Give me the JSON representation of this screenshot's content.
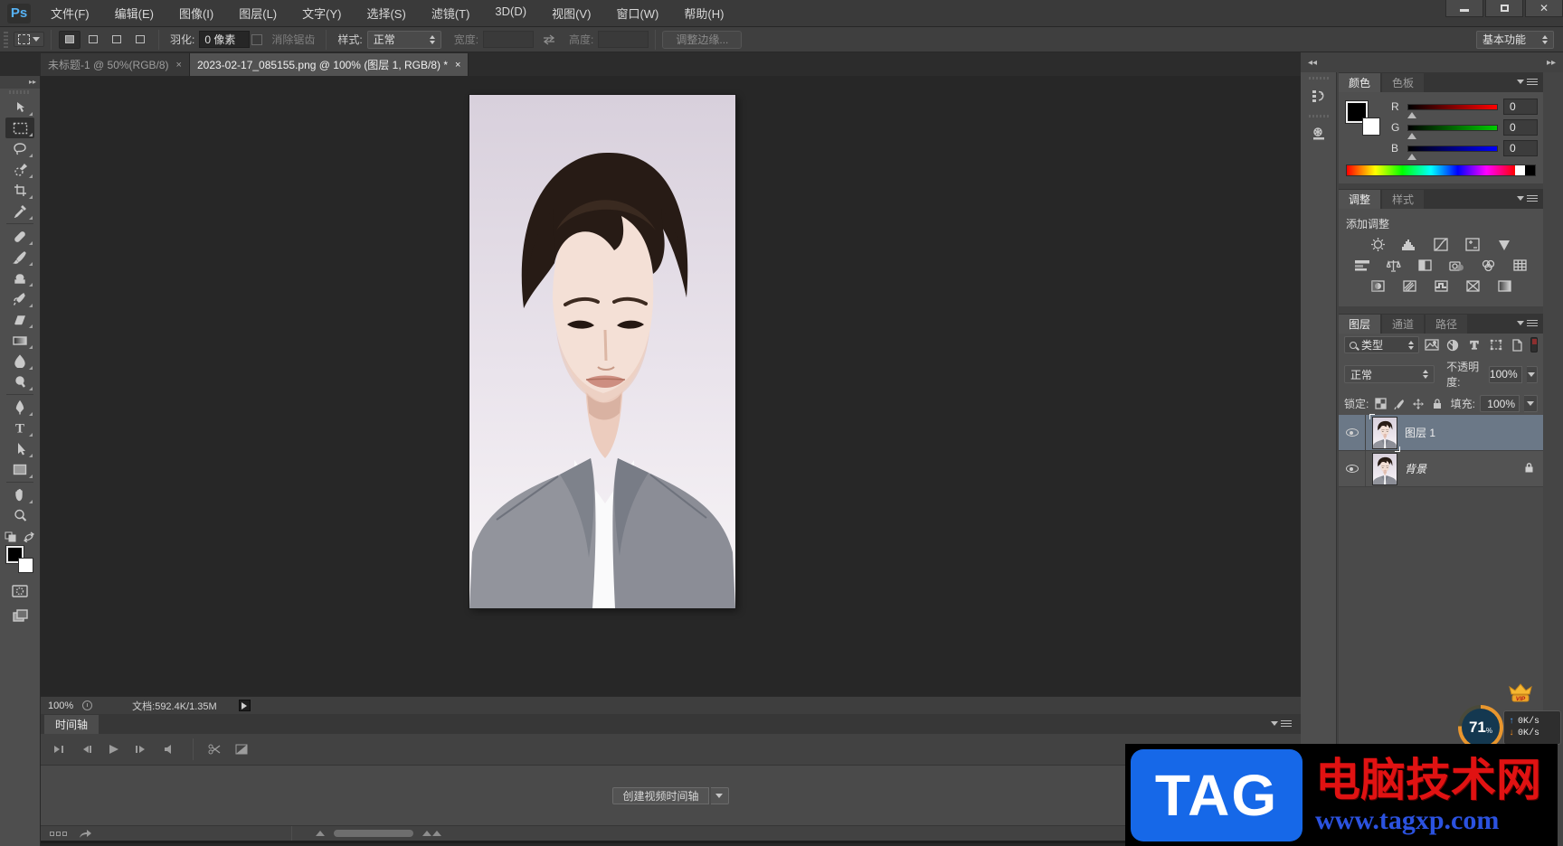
{
  "titlebar": {
    "logo": "Ps",
    "menus": [
      {
        "label": "文件(F)"
      },
      {
        "label": "编辑(E)"
      },
      {
        "label": "图像(I)"
      },
      {
        "label": "图层(L)"
      },
      {
        "label": "文字(Y)"
      },
      {
        "label": "选择(S)"
      },
      {
        "label": "滤镜(T)"
      },
      {
        "label": "3D(D)"
      },
      {
        "label": "视图(V)"
      },
      {
        "label": "窗口(W)"
      },
      {
        "label": "帮助(H)"
      }
    ]
  },
  "optionsbar": {
    "feather_label": "羽化:",
    "feather_value": "0 像素",
    "antialias_label": "消除锯齿",
    "style_label": "样式:",
    "style_value": "正常",
    "width_label": "宽度:",
    "height_label": "高度:",
    "refine_edge_label": "调整边缘...",
    "workspace_label": "基本功能"
  },
  "document_tabs": [
    {
      "title": "未标题-1 @ 50%(RGB/8)",
      "close": "×"
    },
    {
      "title": "2023-02-17_085155.png @ 100% (图层 1, RGB/8) *",
      "close": "×"
    }
  ],
  "color_panel": {
    "tab_color": "颜色",
    "tab_swatches": "色板",
    "channels": [
      {
        "label": "R",
        "value": "0"
      },
      {
        "label": "G",
        "value": "0"
      },
      {
        "label": "B",
        "value": "0"
      }
    ]
  },
  "adjust_panel": {
    "tab_adjust": "调整",
    "tab_styles": "样式",
    "add_label": "添加调整"
  },
  "layers_panel": {
    "tab_layers": "图层",
    "tab_channels": "通道",
    "tab_paths": "路径",
    "filter_label": "类型",
    "blend_mode": "正常",
    "opacity_label": "不透明度:",
    "opacity_value": "100%",
    "lock_label": "锁定:",
    "fill_label": "填充:",
    "fill_value": "100%",
    "layers": [
      {
        "name": "图层 1"
      },
      {
        "name": "背景"
      }
    ]
  },
  "statusbar": {
    "zoom": "100%",
    "doc_info": "文档:592.4K/1.35M"
  },
  "timeline": {
    "tab": "时间轴",
    "create_button_label": "创建视频时间轴"
  },
  "watermark": {
    "logo_text": "TAG",
    "site_name": "电脑技术网",
    "site_url": "www.tagxp.com"
  },
  "net_widget": {
    "percent": "71",
    "percent_unit": "%",
    "up_speed": "0K/s",
    "down_speed": "0K/s"
  },
  "colors": {
    "ps_logo_blue": "#56b2f5",
    "selected_layer_bg": "#6b7887",
    "watermark_logo_bg": "#1668e8",
    "watermark_title_red": "#e01212",
    "watermark_url_blue": "#2b52e0",
    "gauge_ring_orange": "#e8962e"
  }
}
